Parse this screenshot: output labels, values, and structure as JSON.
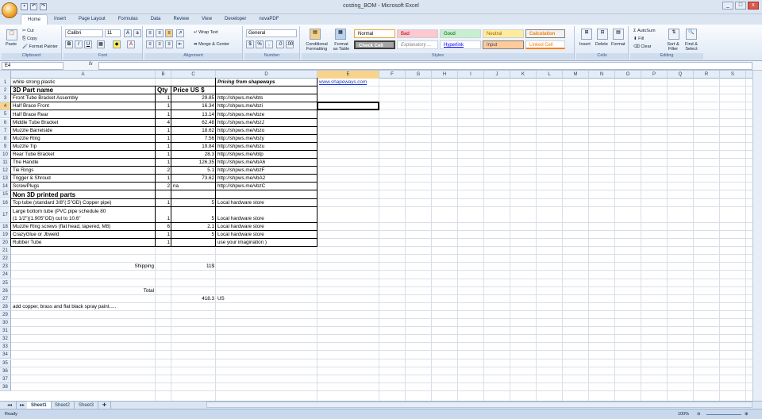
{
  "window": {
    "title": "costing_BOM - Microsoft Excel",
    "controls": [
      "_",
      "□",
      "x"
    ]
  },
  "tabs": [
    "Home",
    "Insert",
    "Page Layout",
    "Formulas",
    "Data",
    "Review",
    "View",
    "Developer",
    "novaPDF"
  ],
  "ribbon": {
    "clipboard": {
      "paste": "Paste",
      "cut": "Cut",
      "copy": "Copy",
      "format_painter": "Format Painter",
      "label": "Clipboard"
    },
    "font": {
      "name": "Calibri",
      "size": "11",
      "label": "Font",
      "bold": "B",
      "italic": "I",
      "underline": "U"
    },
    "alignment": {
      "wrap": "Wrap Text",
      "merge": "Merge & Center",
      "label": "Alignment"
    },
    "number": {
      "format": "General",
      "currency": "$",
      "percent": "%",
      "comma": ",",
      "label": "Number"
    },
    "styles": {
      "conditional": "Conditional Formatting",
      "format_table": "Format as Table",
      "cells": [
        "Normal",
        "Bad",
        "Good",
        "Neutral",
        "Calculation",
        "Check Cell",
        "Explanatory ...",
        "Hyperlink",
        "Input",
        "Linked Cell"
      ],
      "label": "Styles"
    },
    "cells": {
      "insert": "Insert",
      "delete": "Delete",
      "format": "Format",
      "label": "Cells"
    },
    "editing": {
      "autosum": "AutoSum",
      "fill": "Fill",
      "clear": "Clear",
      "sort": "Sort & Filter",
      "find": "Find & Select",
      "label": "Editing"
    }
  },
  "formula_bar": {
    "name_box": "E4",
    "fx": "fx",
    "value": ""
  },
  "columns": [
    "A",
    "B",
    "C",
    "D",
    "E",
    "F",
    "G",
    "H",
    "I",
    "J",
    "K",
    "L",
    "M",
    "N",
    "O",
    "P",
    "Q",
    "R",
    "S"
  ],
  "rows": [
    "1",
    "2",
    "3",
    "4",
    "5",
    "6",
    "7",
    "8",
    "9",
    "10",
    "11",
    "12",
    "13",
    "14",
    "15",
    "16",
    "17",
    "18",
    "19",
    "20",
    "21",
    "22",
    "23",
    "24",
    "25",
    "26",
    "27",
    "28",
    "29",
    "30",
    "31",
    "32",
    "33",
    "34",
    "35",
    "36",
    "37",
    "38"
  ],
  "sheet": {
    "r1": {
      "a": "white strong plastic",
      "d": "Pricing from shapeways",
      "e": "www.shapeways.com"
    },
    "r2": {
      "a": "3D Part name",
      "b": "Qty",
      "c": "Price US $"
    },
    "parts": [
      {
        "a": "Front Tube Bracket Assembly",
        "b": "1",
        "c": "29.85",
        "d": "http://shpws.me/vbts"
      },
      {
        "a": "Half Brace Front",
        "b": "1",
        "c": "16.34",
        "d": "http://shpws.me/vbzi"
      },
      {
        "a": "Half Brace Rear",
        "b": "1",
        "c": "13.14",
        "d": "http://shpws.me/vbze"
      },
      {
        "a": "Middle Tube Bracket",
        "b": "4",
        "c": "62.48",
        "d": "http://shpws.me/vbzJ"
      },
      {
        "a": "Muzzle Barrelside",
        "b": "1",
        "c": "18.62",
        "d": "http://shpws.me/vbzo"
      },
      {
        "a": "Muzzle Ring",
        "b": "1",
        "c": "7.56",
        "d": "http://shpws.me/vbzy"
      },
      {
        "a": "Muzzle Tip",
        "b": "1",
        "c": "19.84",
        "d": "http://shpws.me/vbzu"
      },
      {
        "a": "Rear Tube Bracket",
        "b": "1",
        "c": "28.3",
        "d": "http://shpws.me/vbtp"
      },
      {
        "a": "The Handle",
        "b": "1",
        "c": "126.35",
        "d": "http://shpws.me/vbA6"
      },
      {
        "a": "Tie Rings",
        "b": "2",
        "c": "5.1",
        "d": "http://shpws.me/vbzF"
      },
      {
        "a": "Trigger & Shroud",
        "b": "1",
        "c": "73.62",
        "d": "http://shpws.me/vbA2"
      },
      {
        "a": "ScrewPlugs",
        "b": "2",
        "c": "na",
        "d": "http://shpws.me/vbzC"
      }
    ],
    "r15": {
      "a": "Non 3D printed parts"
    },
    "r16": {
      "a": "Top tube (standard 3/8\"(.5\"OD) Copper pipe)",
      "b": "1",
      "c": "5",
      "d": "Local hardware store"
    },
    "r17": {
      "a1": "Large bottom tube (PVC pipe schedule 80",
      "a2": "(1 1/2\")(1.905\"OD) cut to 10.6\"",
      "b": "1",
      "c": "5",
      "d": "Local hardware store"
    },
    "r18": {
      "a": "Muzzle Ring screws (flat head, tapered, M8)",
      "b": "6",
      "c": "2.1",
      "d": "Local hardware store"
    },
    "r19": {
      "a": "CrazyGlue or Jbweld",
      "b": "1",
      "c": "5",
      "d": "Local hardware store"
    },
    "r20": {
      "a": "Rubber Tube",
      "b": "1",
      "d": "use your imagination )"
    },
    "r23": {
      "a": "Shipping",
      "c": "11$"
    },
    "r26": {
      "a": "Total"
    },
    "r27": {
      "c": "418.3",
      "d": "US"
    },
    "r28": {
      "a": "add copper, brass and flat black spray paint....."
    }
  },
  "sheet_tabs": [
    "Sheet1",
    "Sheet2",
    "Sheet3"
  ],
  "status": {
    "ready": "Ready",
    "zoom": "100%"
  }
}
